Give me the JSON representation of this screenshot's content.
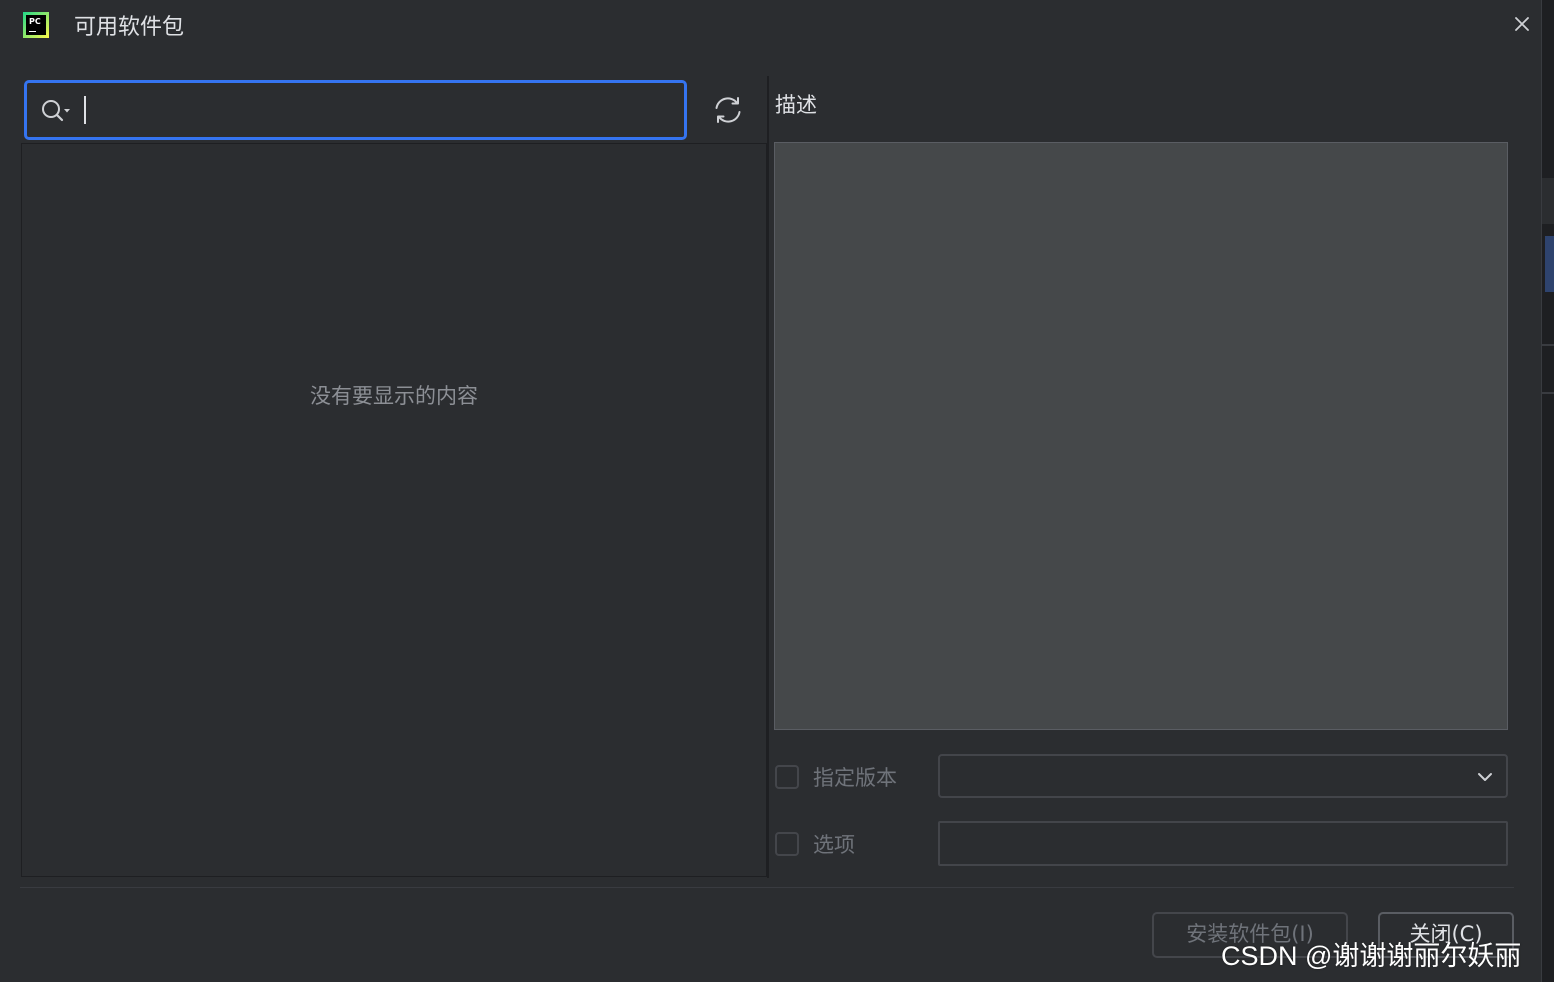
{
  "window": {
    "title": "可用软件包"
  },
  "search": {
    "value": "",
    "placeholder": ""
  },
  "package_list": {
    "empty_text": "没有要显示的内容"
  },
  "description": {
    "label": "描述"
  },
  "options": {
    "specify_version_label": "指定版本",
    "version_value": "",
    "options_label": "选项",
    "options_value": ""
  },
  "buttons": {
    "install_label": "安装软件包(I)",
    "close_label": "关闭(C)"
  },
  "watermark": {
    "text": "CSDN @谢谢谢丽尔妖丽"
  },
  "colors": {
    "background": "#2b2d30",
    "accent": "#3574f0",
    "description_panel": "#45484a"
  },
  "icons": {
    "app": "pycharm-logo-icon",
    "close": "close-icon",
    "search": "search-icon",
    "refresh": "refresh-icon",
    "dropdown": "chevron-down-icon"
  }
}
